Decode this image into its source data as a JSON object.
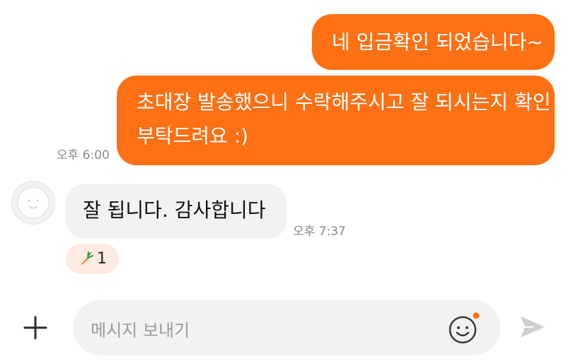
{
  "messages": {
    "outgoing_1": "네 입금확인 되었습니다~",
    "outgoing_2_line1": "초대장 발송했으니 수락해주시고 잘 되시는지 확인",
    "outgoing_2_line2": "부탁드려요 :)",
    "outgoing_time": "오후 6:00",
    "incoming_1": "잘 됩니다. 감사합니다",
    "incoming_time": "오후 7:37"
  },
  "reaction": {
    "icon": "carrot-icon",
    "count": "1"
  },
  "composer": {
    "placeholder": "메시지 보내기",
    "add_icon": "plus-icon",
    "emoji_icon": "smiley-icon",
    "send_icon": "send-icon"
  },
  "colors": {
    "outgoing_bubble": "#fd7014",
    "incoming_bubble": "#f2f2f4",
    "reaction_bg": "#fdebe1",
    "notification_dot": "#fd7014"
  }
}
